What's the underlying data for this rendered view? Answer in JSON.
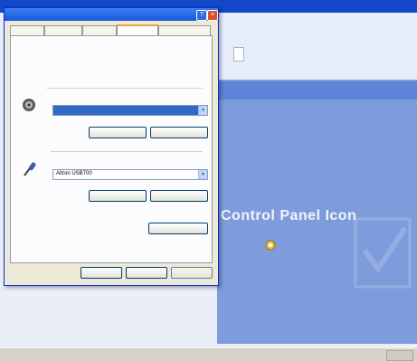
{
  "background": {
    "heading": "Control Panel Icon",
    "link_items": [
      "",
      "",
      "",
      ""
    ],
    "tray_text": ""
  },
  "dialog": {
    "title": "",
    "tabs": [
      "",
      "",
      "",
      "",
      ""
    ],
    "active_tab_index": 3,
    "description": "",
    "playback_group_label": "",
    "playback_device_label": "",
    "playback_selected": "",
    "recording_group_label": "",
    "recording_device_label": "",
    "recording_selected": "Altron USB700",
    "buttons": {
      "playback_volume": "",
      "playback_advanced": "",
      "recording_volume": "",
      "recording_advanced": "",
      "test_hardware": "",
      "ok": "",
      "cancel": "",
      "apply": ""
    }
  },
  "colors": {
    "titlebar": "#1857d8",
    "panel": "#7e9cdc",
    "dialog": "#ece9d8",
    "selection": "#316ac5"
  },
  "icons": {
    "playback": "speaker-icon",
    "recording": "microphone-icon",
    "control_panel": "gear-icon"
  }
}
